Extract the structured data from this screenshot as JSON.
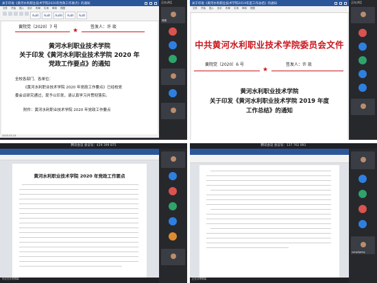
{
  "q1": {
    "title": "关于印发《黄河水利职业技术学院2020年党政工作要点》的通知",
    "meeting_label": "正在讲话",
    "doc_number": "黄院党〔2020〕7 号",
    "signer": "签发人：许  琰",
    "org": "黄河水利职业技术学院",
    "subject_line1": "关于印发《黄河水利职业技术学院 2020 年",
    "subject_line2": "党政工作要点》的通知",
    "greeting": "全校各部门、各单位：",
    "body_line1": "《黄河水利职业技术学院 2020 年党政工作要点》已经校党",
    "body_line2": "委会议研究通过，现予以印发，请认真学习并贯彻落实。",
    "attachment": "附件：黄河水利职业技术学院 2020 年党政工作要点",
    "clock": "2020-03-24",
    "participants": [
      "林燕",
      "",
      "",
      "",
      "",
      "",
      ""
    ]
  },
  "q2": {
    "title": "关于印发《黄河水利职业技术学院2019年度工作总结》的通知",
    "meeting_label": "正在讲话",
    "header": "中共黄河水利职业技术学院委员会文件",
    "doc_number": "黄院党〔2020〕6 号",
    "signer": "签发人：许  琰",
    "org": "黄河水利职业技术学院",
    "subject_line1": "关于印发《黄河水利职业技术学院 2019 年度",
    "subject_line2": "工作总结》的通知"
  },
  "q3": {
    "meeting_bar": "腾讯会议  会议号：429 399 875",
    "doc_title": "黄河水利职业技术学院 2020 年党政工作要点",
    "status": "你正在共享屏幕",
    "participants": [
      "",
      "",
      "",
      "",
      "",
      "",
      ""
    ]
  },
  "q4": {
    "meeting_bar": "腾讯会议  会议号：137 762 891",
    "status": "正在共享屏幕",
    "participants": [
      "",
      "",
      "",
      "",
      "",
      "yangligeng"
    ]
  }
}
